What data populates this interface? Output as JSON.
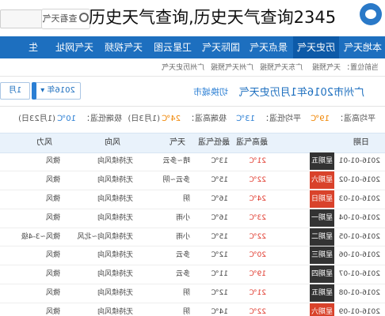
{
  "overlay_title": "历史天气查询,历史天气查询2345",
  "header": {
    "search_button_label": "查看天气",
    "logo_icon": "2345-logo-icon"
  },
  "nav": [
    {
      "label": "本地天气"
    },
    {
      "label": "历史天气",
      "active": true
    },
    {
      "label": "景点天气"
    },
    {
      "label": "国际天气"
    },
    {
      "label": "卫星云图"
    },
    {
      "label": "天气视频"
    },
    {
      "label": "天气网址"
    },
    {
      "label": "生"
    }
  ],
  "breadcrumb": {
    "items": [
      "当前位置：",
      "天气预报",
      "广东天气预报",
      "广州天气预报",
      "广州历史天气"
    ]
  },
  "controls": {
    "year_value": "2016年",
    "month_value": "1月",
    "query_button": "查看",
    "page_title": "广州市2016年1月历史天气",
    "switch_city": "切换城市"
  },
  "summary": {
    "avg_high_label": "平均高温：",
    "avg_high_value": "19℃",
    "avg_low_label": "平均低温：",
    "avg_low_value": "13℃",
    "max_high_label": "极端高温：",
    "max_high_value": "24℃",
    "max_high_date": "(1月3日)",
    "min_low_label": "极端低温：",
    "min_low_value": "10℃",
    "min_low_date": "(1月23日)"
  },
  "table": {
    "columns": [
      "日期",
      "最高气温",
      "最低气温",
      "天气",
      "风向",
      "风力"
    ],
    "rows": [
      {
        "date": "2016-01-01",
        "week": "星期五",
        "week_red": false,
        "high": "21℃",
        "low": "13℃",
        "weather": "晴~多云",
        "dir": "无持续风向",
        "force": "微风"
      },
      {
        "date": "2016-01-02",
        "week": "星期六",
        "week_red": true,
        "high": "22℃",
        "low": "15℃",
        "weather": "多云~阴",
        "dir": "无持续风向",
        "force": "微风"
      },
      {
        "date": "2016-01-03",
        "week": "星期日",
        "week_red": true,
        "high": "24℃",
        "low": "16℃",
        "weather": "阴",
        "dir": "无持续风向",
        "force": "微风"
      },
      {
        "date": "2016-01-04",
        "week": "星期一",
        "week_red": false,
        "high": "23℃",
        "low": "16℃",
        "weather": "小雨",
        "dir": "无持续风向",
        "force": "微风"
      },
      {
        "date": "2016-01-05",
        "week": "星期二",
        "week_red": false,
        "high": "22℃",
        "low": "15℃",
        "weather": "小雨",
        "dir": "无持续风向~北风",
        "force": "微风~3-4级"
      },
      {
        "date": "2016-01-06",
        "week": "星期三",
        "week_red": false,
        "high": "20℃",
        "low": "12℃",
        "weather": "多云",
        "dir": "无持续风向",
        "force": "微风"
      },
      {
        "date": "2016-01-07",
        "week": "星期四",
        "week_red": false,
        "high": "19℃",
        "low": "11℃",
        "weather": "多云",
        "dir": "无持续风向",
        "force": "微风"
      },
      {
        "date": "2016-01-08",
        "week": "星期五",
        "week_red": false,
        "high": "21℃",
        "low": "12℃",
        "weather": "阴",
        "dir": "无持续风向",
        "force": "微风"
      },
      {
        "date": "2016-01-09",
        "week": "星期六",
        "week_red": true,
        "high": "22℃",
        "low": "14℃",
        "weather": "阴",
        "dir": "无持续风向",
        "force": "微风"
      }
    ]
  },
  "colors": {
    "nav_bg": "#1d6fbf",
    "high_temp": "#e0372b",
    "accent": "#2b7fd4"
  }
}
